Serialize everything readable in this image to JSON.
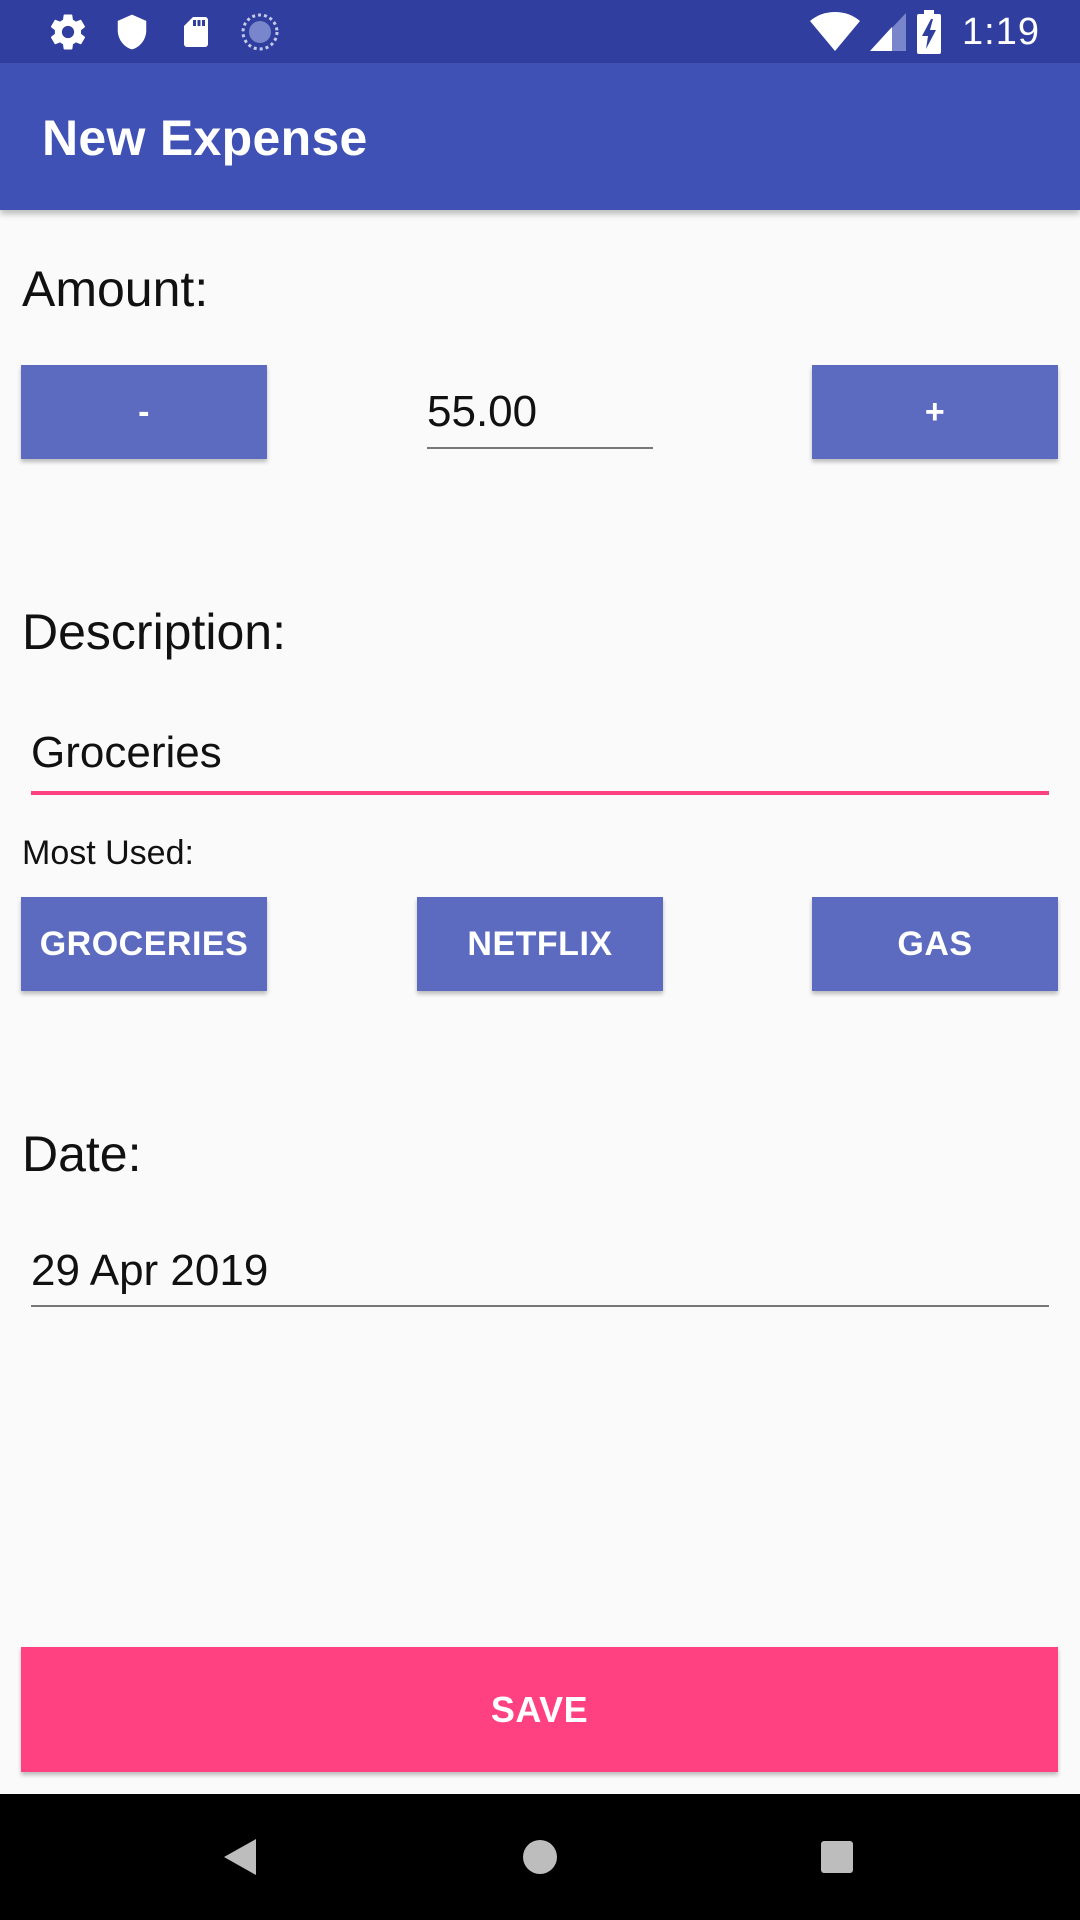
{
  "status_bar": {
    "time": "1:19",
    "icons_left": [
      "gear-icon",
      "shield-icon",
      "sd-card-icon",
      "sync-icon"
    ],
    "icons_right": [
      "wifi-icon",
      "signal-icon",
      "battery-charging-icon"
    ]
  },
  "app_bar": {
    "title": "New Expense"
  },
  "amount": {
    "label": "Amount:",
    "decrement_label": "-",
    "value": "55.00",
    "increment_label": "+"
  },
  "description": {
    "label": "Description:",
    "value": "Groceries",
    "most_used_label": "Most Used:",
    "most_used": [
      "GROCERIES",
      "NETFLIX",
      "GAS"
    ]
  },
  "date": {
    "label": "Date:",
    "value": "29 Apr 2019"
  },
  "save_label": "SAVE",
  "colors": {
    "status_bar": "#303F9F",
    "primary": "#3F51B5",
    "button": "#5C6BC0",
    "accent": "#FF4081",
    "background": "#FAFAFA"
  },
  "nav_bar": {
    "icons": [
      "back-icon",
      "home-icon",
      "recents-icon"
    ]
  }
}
